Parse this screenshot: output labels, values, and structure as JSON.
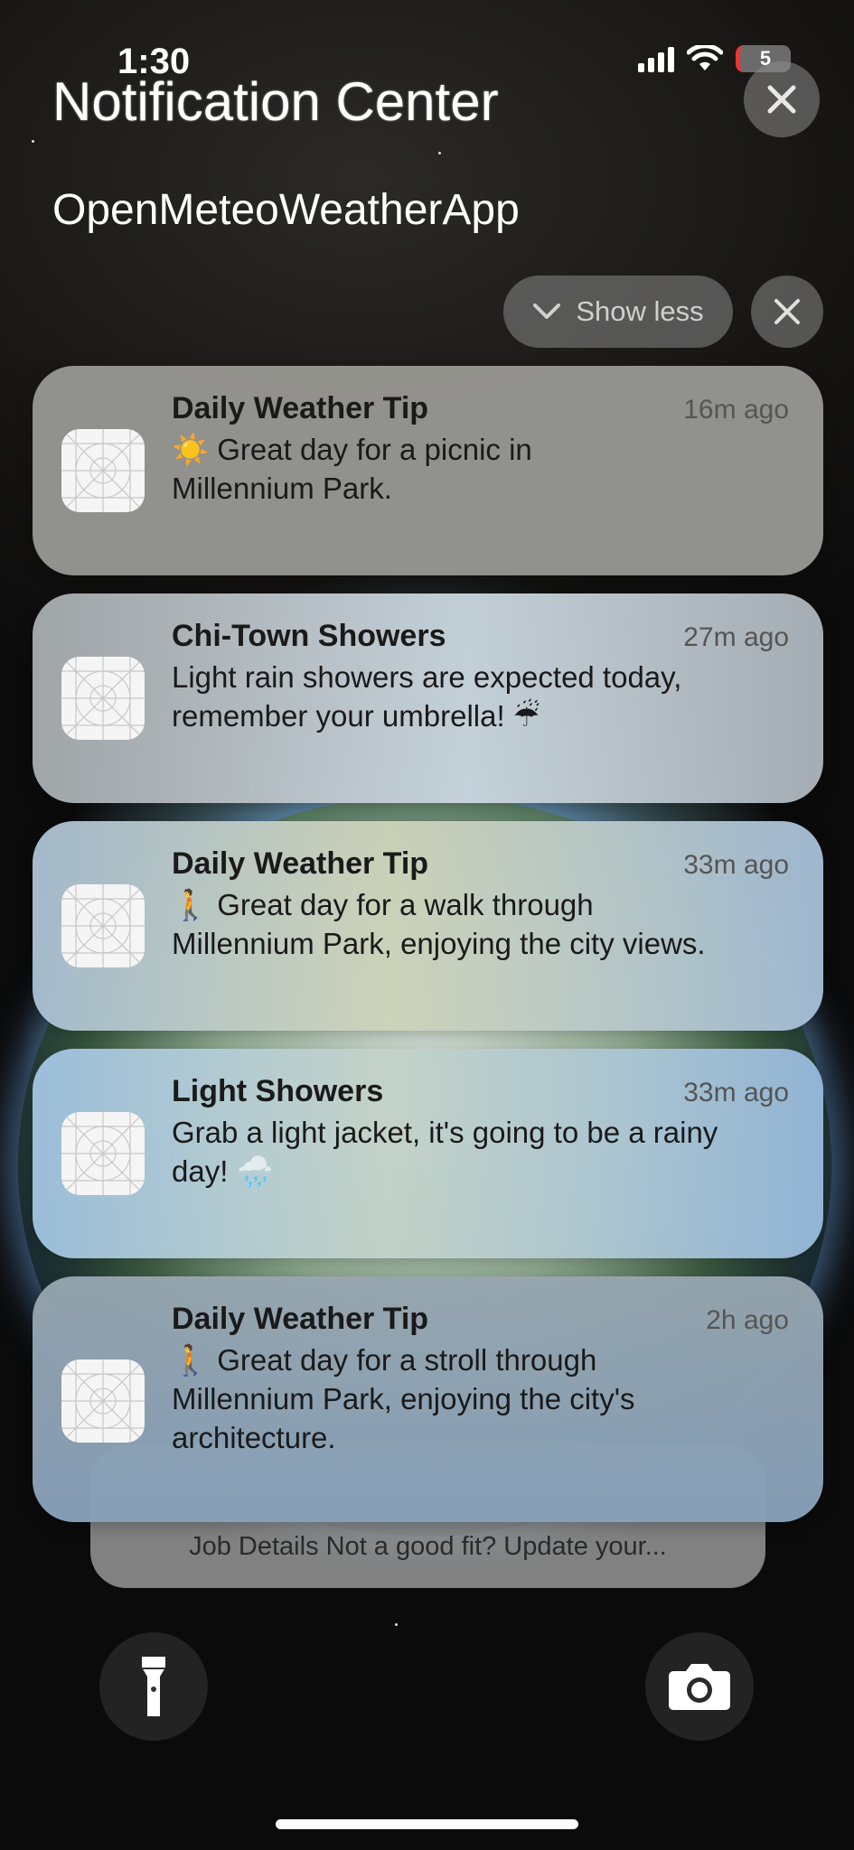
{
  "status_bar": {
    "time": "1:30",
    "battery_level": "5"
  },
  "header": {
    "title": "Notification Center",
    "app_name": "OpenMeteoWeatherApp"
  },
  "controls": {
    "show_less_label": "Show less"
  },
  "notifications": [
    {
      "title": "Daily Weather Tip",
      "time": "16m ago",
      "body_line1": "☀️ Great day for a picnic in",
      "body_line2": "Millennium Park.",
      "body_line3": ""
    },
    {
      "title": "Chi-Town Showers",
      "time": "27m ago",
      "body_line1": "Light rain showers are expected today,",
      "body_line2": "remember your umbrella! ☔",
      "body_line3": ""
    },
    {
      "title": "Daily Weather Tip",
      "time": "33m ago",
      "body_line1": "🚶 Great day for a walk through",
      "body_line2": "Millennium Park, enjoying the city views.",
      "body_line3": ""
    },
    {
      "title": "Light Showers",
      "time": "33m ago",
      "body_line1": "Grab a light jacket, it's going to be a rainy",
      "body_line2": "day! 🌧️",
      "body_line3": ""
    },
    {
      "title": "Daily Weather Tip",
      "time": "2h ago",
      "body_line1": "🚶 Great day for a stroll through",
      "body_line2": "Millennium Park, enjoying the city's",
      "body_line3": "architecture."
    }
  ],
  "stacked_notification": {
    "text": "Job Details Not a good fit? Update your..."
  },
  "icons": {
    "flashlight": "flashlight-icon",
    "camera": "camera-icon",
    "close": "close-icon",
    "chevron": "chevron-down-icon",
    "app": "app-placeholder-icon"
  }
}
